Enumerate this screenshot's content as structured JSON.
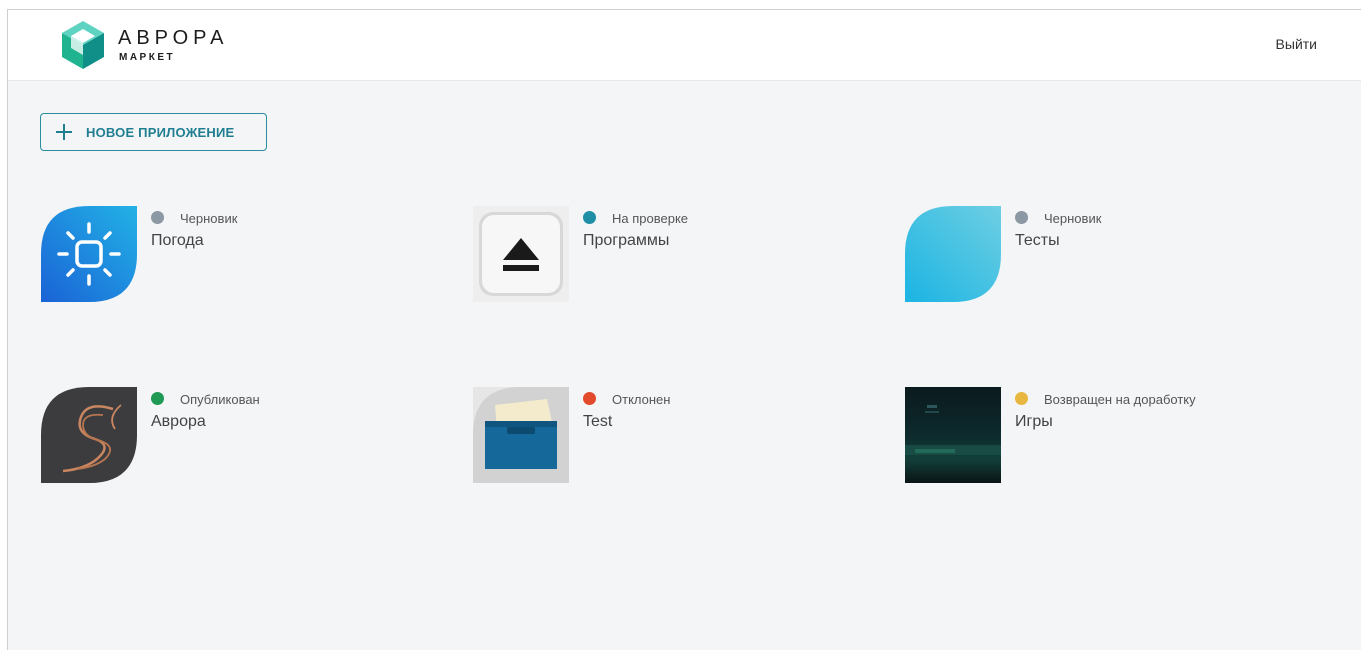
{
  "header": {
    "logo_title": "АВРОРА",
    "logo_subtitle": "МАРКЕТ",
    "logout_label": "Выйти"
  },
  "toolbar": {
    "new_app_label": "НОВОЕ ПРИЛОЖЕНИЕ"
  },
  "status_colors": {
    "draft": "#8c98a4",
    "review": "#1f8fa6",
    "published": "#1e9a55",
    "rejected": "#e34a2b",
    "returned": "#e8b73f"
  },
  "apps": [
    {
      "name": "Погода",
      "status": "Черновик",
      "status_color": "#8c98a4",
      "icon": "weather-icon"
    },
    {
      "name": "Программы",
      "status": "На проверке",
      "status_color": "#1f8fa6",
      "icon": "eject-icon"
    },
    {
      "name": "Тесты",
      "status": "Черновик",
      "status_color": "#8c98a4",
      "icon": "leaf-icon"
    },
    {
      "name": "Аврора",
      "status": "Опубликован",
      "status_color": "#1e9a55",
      "icon": "aurora-icon"
    },
    {
      "name": "Test",
      "status": "Отклонен",
      "status_color": "#e34a2b",
      "icon": "drawer-icon"
    },
    {
      "name": "Игры",
      "status": "Возвращен на доработку",
      "status_color": "#e8b73f",
      "icon": "game-screenshot-icon"
    }
  ]
}
